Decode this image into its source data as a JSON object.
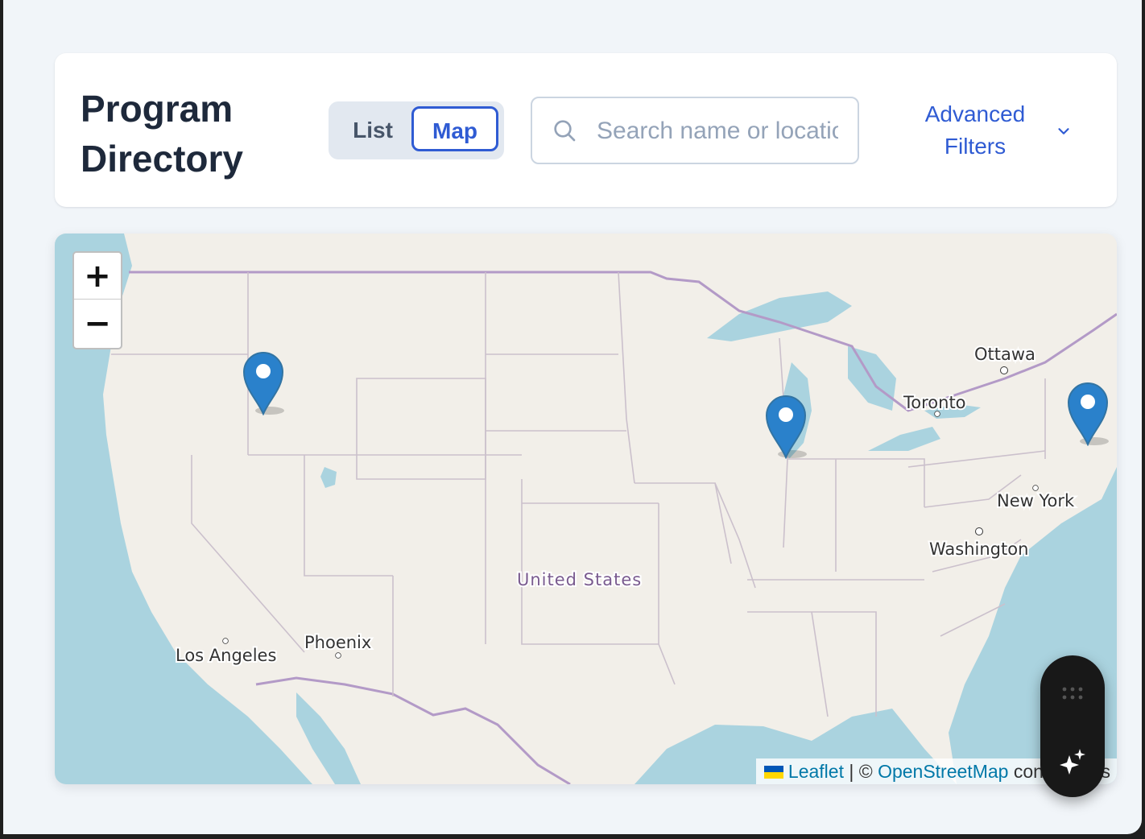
{
  "header": {
    "title": "Program Directory",
    "view_toggle": {
      "list_label": "List",
      "map_label": "Map",
      "selected": "Map"
    },
    "search": {
      "placeholder": "Search name or location",
      "value": ""
    },
    "filters_label": "Advanced Filters",
    "accent_color": "#2f5bd3"
  },
  "map": {
    "zoom_in_label": "+",
    "zoom_out_label": "−",
    "place_labels": {
      "ottawa": "Ottawa",
      "toronto": "Toronto",
      "new_york": "New York",
      "washington": "Washington",
      "united_states": "United States",
      "los_angeles": "Los Angeles",
      "phoenix": "Phoenix"
    },
    "marker_count": 3,
    "marker_icon": "map-pin-icon",
    "attribution": {
      "leaflet": "Leaflet",
      "separator": "| ©",
      "osm": "OpenStreetMap",
      "suffix": "contributors"
    }
  },
  "assistant": {
    "icons": [
      "grip-icon",
      "sparkle-icon"
    ]
  }
}
